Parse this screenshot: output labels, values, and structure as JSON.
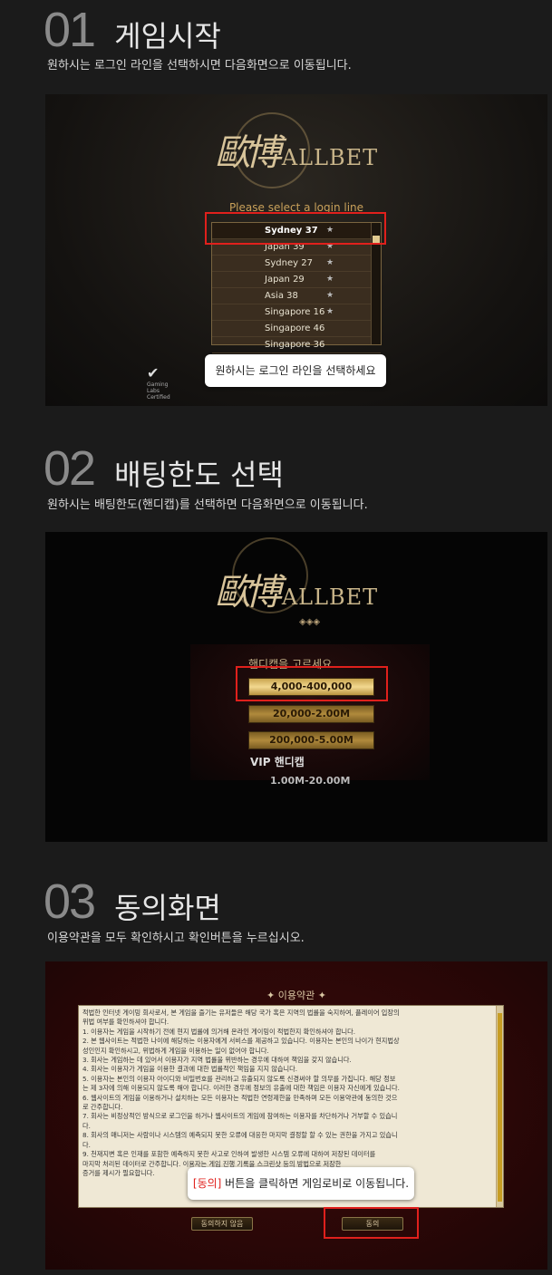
{
  "steps": [
    {
      "num": "01",
      "title": "게임시작",
      "desc": "원하시는 로그인 라인을 선택하시면 다음화면으로 이동됩니다.",
      "logo_han": "歐博",
      "logo_brand": "ALLBET",
      "login_caption": "Please select a login line",
      "login_lines": [
        {
          "name": "Sydney 37",
          "star": "★"
        },
        {
          "name": "Japan 39",
          "star": "★"
        },
        {
          "name": "Sydney 27",
          "star": "★"
        },
        {
          "name": "Japan 29",
          "star": "★"
        },
        {
          "name": "Asia 38",
          "star": "★"
        },
        {
          "name": "Singapore 16",
          "star": "★"
        },
        {
          "name": "Singapore 46",
          "star": ""
        },
        {
          "name": "Singapore 36",
          "star": ""
        }
      ],
      "tooltip": "원하시는 로그인 라인을 선택하세요",
      "cert": [
        "Gaming",
        "Labs",
        "Certified"
      ]
    },
    {
      "num": "02",
      "title": "배팅한도 선택",
      "desc": "원하시는 배팅한도(핸디캡)를 선택하면 다음화면으로 이동됩니다.",
      "logo_han": "歐博",
      "logo_brand": "ALLBET",
      "ornament": "◈◈◈",
      "handicap_caption": "핸디캡을 고르세요",
      "handicaps": [
        "4,000-400,000",
        "20,000-2.00M",
        "200,000-5.00M"
      ],
      "vip_label": "VIP 핸디캡",
      "vip_range": "1.00M-20.00M"
    },
    {
      "num": "03",
      "title": "동의화면",
      "desc": "이용약관을 모두 확인하시고 확인버튼을 누르십시오.",
      "terms_title": "✦ 이용약관 ✦",
      "terms_lines": [
        "적법한 인터넷 게이밍 회사로서, 본 게임을 즐기는 유저들은 해당 국가 혹은 지역의 법률을 숙지하여, 플레이어 입장의",
        "위법 여부를 확인하셔야 합니다.",
        "1. 이용자는 게임을 시작하기 전에 현지 법률에 의거해 온라인 게이밍이 적법한지 확인하셔야 합니다.",
        "2. 본 웹사이트는 적법한 나이에 해당하는 이용자에게 서비스를 제공하고 있습니다. 이용자는 본인의 나이가 현지법상",
        "성인인지 확인하시고, 위법하게 게임을 이용하는 일이 없어야 합니다.",
        "3. 회사는 게임하는 데 있어서 이용자가 지역 법률을 위반하는 경우에 대하여 책임을 갖지 않습니다.",
        "4. 회사는 이용자가 게임을 이용한 결과에 대한 법률적인 책임을 지지 않습니다.",
        "5. 이용자는 본인의 이용자 아이디와 비밀번호를 관리하고 유출되지 않도록 신경써야 할 의무를 가집니다. 해당 정보",
        "는 제 3자에 의해 이용되지 않도록 해야 합니다. 이러한 경우에 정보의 유출에 대한 책임은 이용자 자신에게 있습니다.",
        "6. 웹사이트의 게임을 이용하거나 설치하는 모든 이용자는 적법한 연령제한을 만족하며 모든 이용약관에 동의한 것으",
        "로 간주합니다.",
        "7. 회사는 비정상적인 방식으로 로그인을 하거나 웹사이트의 게임에 참여하는 이용자를 차단하거나 거부할 수 있습니",
        "다.",
        "8. 회사의 매니저는 사람이나 시스템의 예측되지 못한 오류에 대응한 마지막 결정할 할 수 있는 권한을 가지고 있습니",
        "다.",
        "9. 천재지변 혹은 인재를 포함한 예측하지 못한 사고로 인하여 발생한 시스템 오류에 대하여 저장된 데이터를",
        "마지막 처리된 데이터로 간주합니다. 이용자는 게임 진행 기록을 스크린샷 등의 방법으로 저장한",
        "증거를 제시가 필요합니다."
      ],
      "disagree_label": "동의하지 않음",
      "agree_label": "동의",
      "tooltip_highlight": "[동의]",
      "tooltip_rest": " 버튼을 클릭하면 게임로비로 이동됩니다."
    }
  ],
  "colors": {
    "highlight": "#e0201c",
    "gold": "#c9a15a"
  }
}
